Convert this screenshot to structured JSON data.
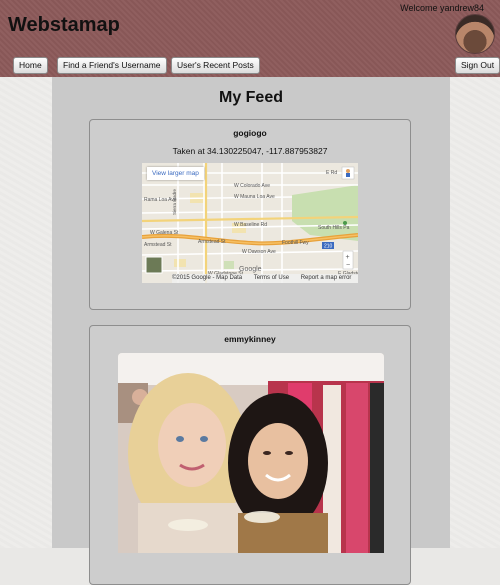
{
  "header": {
    "brand": "Webstamap",
    "welcome": "Welcome yandrew84",
    "nav": {
      "home": "Home",
      "find_friend": "Find a Friend's Username",
      "recent_posts": "User's Recent Posts"
    },
    "sign_out": "Sign Out"
  },
  "feed": {
    "title": "My Feed",
    "posts": [
      {
        "username": "gogiogo",
        "location_text": "Taken at 34.130225047, -117.887953827",
        "map": {
          "larger_map_label": "View larger map",
          "copyright": "©2015 Google - Map Data",
          "terms": "Terms of Use",
          "report": "Report a map error",
          "logo": "Google",
          "labels": [
            "E Rd",
            "W Colorado Ave",
            "W Mauna Loa Ave",
            "Rama Loa Ave",
            "Sierra Madre",
            "W Baseline Rd",
            "W Galena St",
            "Armstead St",
            "Foothill Fwy",
            "Armstead St",
            "W Dawson Ave",
            "W Gladstone St",
            "E Gladstone",
            "South Hills Pa",
            "210",
            "66"
          ]
        }
      },
      {
        "username": "emmykinney"
      }
    ]
  },
  "colors": {
    "header_bg": "#8c5a5a",
    "feed_bg": "#c9c9c9",
    "page_bg": "#e9e8e6"
  }
}
